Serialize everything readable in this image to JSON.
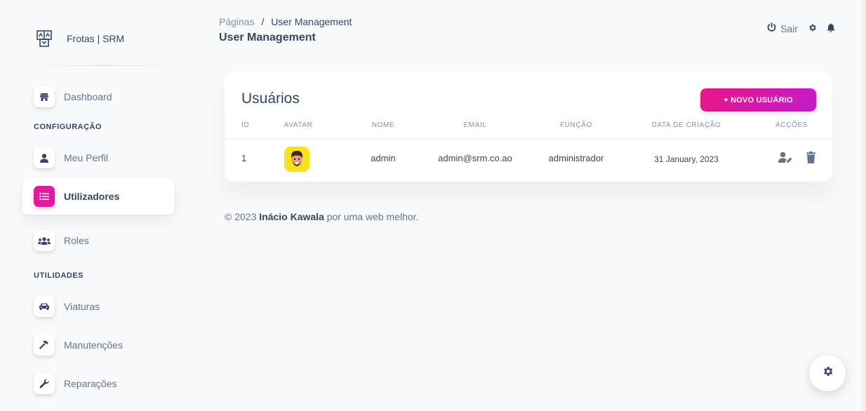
{
  "brand": {
    "name": "Frotas | SRM"
  },
  "sidebar": {
    "items": [
      {
        "label": "Dashboard",
        "icon": "store-icon"
      },
      {
        "label": "Meu Perfil",
        "icon": "user-icon"
      },
      {
        "label": "Utilizadores",
        "icon": "list-icon",
        "active": true
      },
      {
        "label": "Roles",
        "icon": "users-icon"
      },
      {
        "label": "Viaturas",
        "icon": "car-icon"
      },
      {
        "label": "Manutenções",
        "icon": "hammer-icon"
      },
      {
        "label": "Reparações",
        "icon": "wrench-icon"
      }
    ],
    "sections": {
      "config": "CONFIGURAÇÃO",
      "util": "UTILIDADES"
    }
  },
  "header": {
    "breadcrumb_root": "Páginas",
    "breadcrumb_sep": "/",
    "breadcrumb_current": "User Management",
    "title": "User Management",
    "logout_label": "Sair"
  },
  "card": {
    "title": "Usuários",
    "new_button": "+ NOVO USUÁRIO",
    "columns": [
      "ID",
      "AVATAR",
      "NOME",
      "EMAIL",
      "FUNÇÃO",
      "DATA DE CRIAÇÃO",
      "ACÇÕES"
    ],
    "rows": [
      {
        "id": "1",
        "nome": "admin",
        "email": "admin@srm.co.ao",
        "funcao": "administrador",
        "data": "31 January, 2023"
      }
    ]
  },
  "footer": {
    "prefix": "© 2023 ",
    "author": "Inácio Kawala",
    "suffix": " por uma web melhor."
  },
  "colors": {
    "accent": "#e5199b",
    "text": "#344767",
    "muted": "#8392ab"
  }
}
